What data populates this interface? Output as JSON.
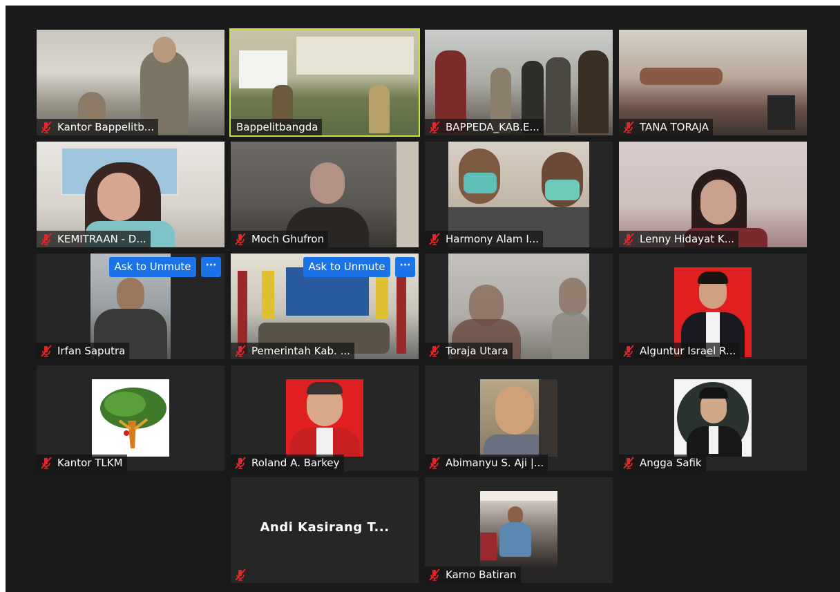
{
  "participants": [
    {
      "name": "Kantor Bappelitb...",
      "muted": true
    },
    {
      "name": "Bappelitbangda",
      "muted": false,
      "active_speaker": true
    },
    {
      "name": "BAPPEDA_KAB.E...",
      "muted": true
    },
    {
      "name": "TANA TORAJA",
      "muted": true
    },
    {
      "name": "KEMITRAAN - D...",
      "muted": true
    },
    {
      "name": "Moch Ghufron",
      "muted": true
    },
    {
      "name": "Harmony Alam I...",
      "muted": true
    },
    {
      "name": "Lenny Hidayat K...",
      "muted": true
    },
    {
      "name": "Irfan Saputra",
      "muted": true,
      "ask_to_unmute": "Ask to Unmute"
    },
    {
      "name": "Pemerintah Kab. ...",
      "muted": true,
      "ask_to_unmute": "Ask to Unmute"
    },
    {
      "name": "Toraja Utara",
      "muted": true
    },
    {
      "name": "Alguntur Israel R...",
      "muted": true
    },
    {
      "name": "Kantor TLKM",
      "muted": true
    },
    {
      "name": "Roland A. Barkey",
      "muted": true
    },
    {
      "name": "Abimanyu S. Aji |...",
      "muted": true
    },
    {
      "name": "Angga Safik",
      "muted": true
    },
    {
      "name": "Andi Kasirang T...",
      "muted": true,
      "video_off": true
    },
    {
      "name": "Karno Batiran",
      "muted": true
    }
  ],
  "more_button_label": "···",
  "colors": {
    "background": "#1a1a1a",
    "tile": "#262626",
    "active_border": "#c8e04a",
    "button": "#1a73e8",
    "muted_icon": "#e02828"
  },
  "icons": {
    "muted": "mic-muted-icon",
    "more": "more-options-icon"
  }
}
